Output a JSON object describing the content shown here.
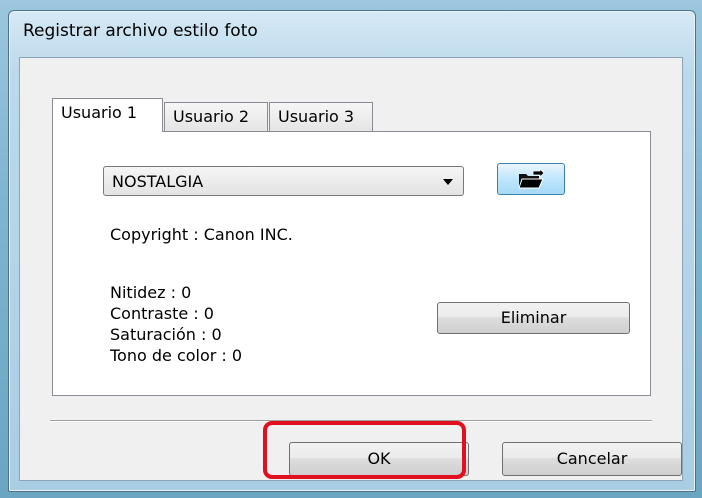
{
  "window": {
    "title": "Registrar archivo estilo foto"
  },
  "tabs": [
    {
      "label": "Usuario 1",
      "active": true
    },
    {
      "label": "Usuario 2",
      "active": false
    },
    {
      "label": "Usuario 3",
      "active": false
    }
  ],
  "style_select": {
    "value": "NOSTALGIA"
  },
  "open_file_button": {
    "icon": "folder-open-icon"
  },
  "info": {
    "copyright": "Copyright : Canon INC.",
    "nitidez": "Nitidez : 0",
    "contraste": "Contraste : 0",
    "saturacion": "Saturación : 0",
    "tono": "Tono de color : 0"
  },
  "buttons": {
    "eliminar": "Eliminar",
    "ok": "OK",
    "cancelar": "Cancelar"
  },
  "colors": {
    "highlight": "#e0101e",
    "accent_button": "#bee6fd"
  }
}
